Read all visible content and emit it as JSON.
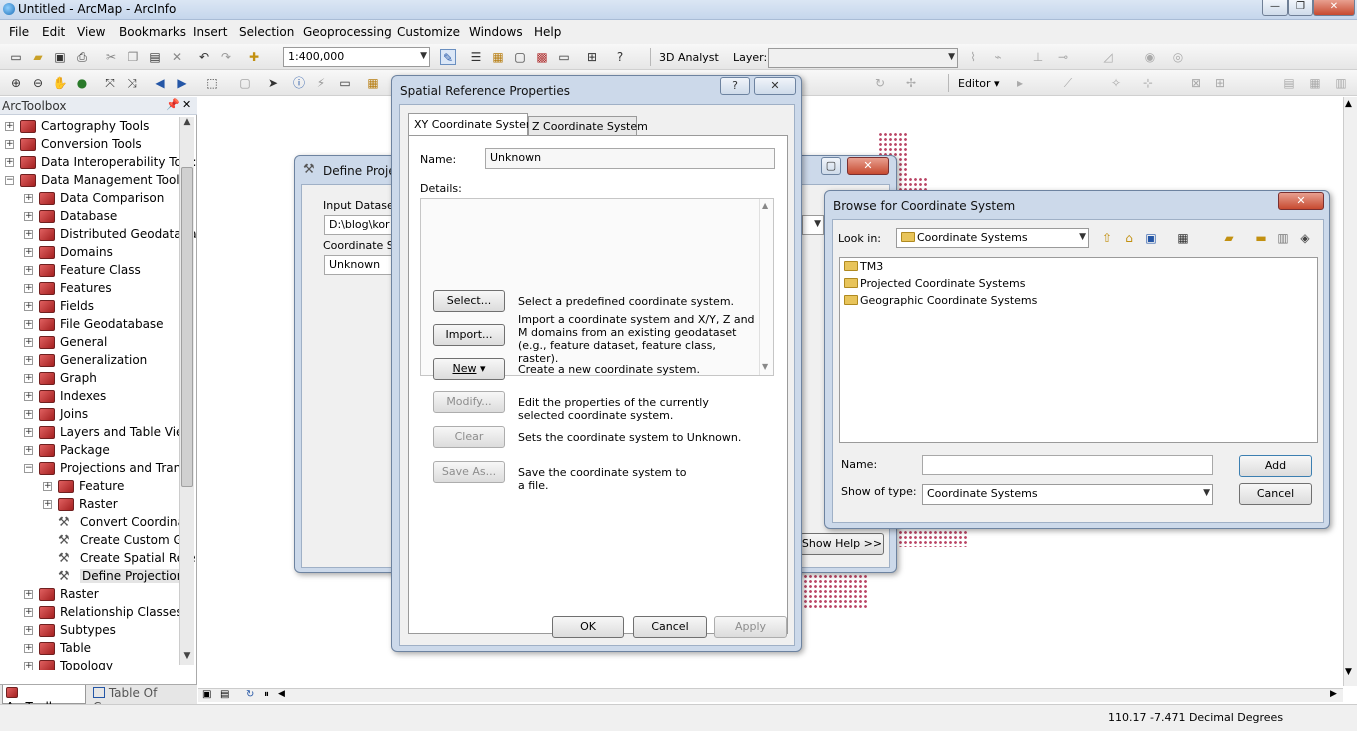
{
  "window": {
    "title": "Untitled - ArcMap - ArcInfo",
    "min": "—",
    "max": "❐",
    "close": "✕"
  },
  "menu": [
    "File",
    "Edit",
    "View",
    "Bookmarks",
    "Insert",
    "Selection",
    "Geoprocessing",
    "Customize",
    "Windows",
    "Help"
  ],
  "toolbar": {
    "scale": "1:400,000",
    "analyst": "3D Analyst",
    "layer_label": "Layer:",
    "editor": "Editor"
  },
  "toolbox": {
    "title": "ArcToolbox",
    "items": [
      {
        "label": "Cartography Tools",
        "level": 0,
        "exp": "+",
        "kind": "toolbox"
      },
      {
        "label": "Conversion Tools",
        "level": 0,
        "exp": "+",
        "kind": "toolbox"
      },
      {
        "label": "Data Interoperability Tool:",
        "level": 0,
        "exp": "+",
        "kind": "toolbox"
      },
      {
        "label": "Data Management Tools",
        "level": 0,
        "exp": "−",
        "kind": "toolbox"
      },
      {
        "label": "Data Comparison",
        "level": 1,
        "exp": "+",
        "kind": "toolbox"
      },
      {
        "label": "Database",
        "level": 1,
        "exp": "+",
        "kind": "toolbox"
      },
      {
        "label": "Distributed Geodataba",
        "level": 1,
        "exp": "+",
        "kind": "toolbox"
      },
      {
        "label": "Domains",
        "level": 1,
        "exp": "+",
        "kind": "toolbox"
      },
      {
        "label": "Feature Class",
        "level": 1,
        "exp": "+",
        "kind": "toolbox"
      },
      {
        "label": "Features",
        "level": 1,
        "exp": "+",
        "kind": "toolbox"
      },
      {
        "label": "Fields",
        "level": 1,
        "exp": "+",
        "kind": "toolbox"
      },
      {
        "label": "File Geodatabase",
        "level": 1,
        "exp": "+",
        "kind": "toolbox"
      },
      {
        "label": "General",
        "level": 1,
        "exp": "+",
        "kind": "toolbox"
      },
      {
        "label": "Generalization",
        "level": 1,
        "exp": "+",
        "kind": "toolbox"
      },
      {
        "label": "Graph",
        "level": 1,
        "exp": "+",
        "kind": "toolbox"
      },
      {
        "label": "Indexes",
        "level": 1,
        "exp": "+",
        "kind": "toolbox"
      },
      {
        "label": "Joins",
        "level": 1,
        "exp": "+",
        "kind": "toolbox"
      },
      {
        "label": "Layers and Table View",
        "level": 1,
        "exp": "+",
        "kind": "toolbox"
      },
      {
        "label": "Package",
        "level": 1,
        "exp": "+",
        "kind": "toolbox"
      },
      {
        "label": "Projections and Transf",
        "level": 1,
        "exp": "−",
        "kind": "toolbox"
      },
      {
        "label": "Feature",
        "level": 2,
        "exp": "+",
        "kind": "toolbox"
      },
      {
        "label": "Raster",
        "level": 2,
        "exp": "+",
        "kind": "toolbox"
      },
      {
        "label": "Convert Coordinat",
        "level": 2,
        "exp": "",
        "kind": "tool"
      },
      {
        "label": "Create Custom Ge",
        "level": 2,
        "exp": "",
        "kind": "tool"
      },
      {
        "label": "Create Spatial Refe",
        "level": 2,
        "exp": "",
        "kind": "tool"
      },
      {
        "label": "Define Projection",
        "level": 2,
        "exp": "",
        "kind": "tool"
      },
      {
        "label": "Raster",
        "level": 1,
        "exp": "+",
        "kind": "toolbox"
      },
      {
        "label": "Relationship Classes",
        "level": 1,
        "exp": "+",
        "kind": "toolbox"
      },
      {
        "label": "Subtypes",
        "level": 1,
        "exp": "+",
        "kind": "toolbox"
      },
      {
        "label": "Table",
        "level": 1,
        "exp": "+",
        "kind": "toolbox"
      },
      {
        "label": "Topology",
        "level": 1,
        "exp": "+",
        "kind": "toolbox"
      }
    ],
    "tabs": [
      "ArcToolbox",
      "Table Of Co..."
    ]
  },
  "define_projection": {
    "title": "Define Projec",
    "input_label": "Input Dataset",
    "input_value": "D:\\blog\\kor",
    "coord_label": "Coordinate Sy",
    "coord_value": "Unknown",
    "show_help": "Show Help >>"
  },
  "srp": {
    "title": "Spatial Reference Properties",
    "help": "?",
    "close": "✕",
    "tab_xy": "XY Coordinate System",
    "tab_z": "Z Coordinate System",
    "name_label": "Name:",
    "name_value": "Unknown",
    "details_label": "Details:",
    "actions": [
      {
        "button": "Select...",
        "desc": "Select a predefined coordinate system.",
        "enabled": true
      },
      {
        "button": "Import...",
        "desc": "Import a coordinate system and X/Y, Z and M domains from an existing geodataset (e.g., feature dataset, feature class, raster).",
        "enabled": true
      },
      {
        "button": "New",
        "desc": "Create a new coordinate system.",
        "enabled": true
      },
      {
        "button": "Modify...",
        "desc": "Edit the properties of the currently selected coordinate system.",
        "enabled": false
      },
      {
        "button": "Clear",
        "desc": "Sets the coordinate system to Unknown.",
        "enabled": false
      },
      {
        "button": "Save As...",
        "desc": "Save the coordinate system to a file.",
        "enabled": false
      }
    ],
    "ok": "OK",
    "cancel": "Cancel",
    "apply": "Apply"
  },
  "browse": {
    "title": "Browse for Coordinate System",
    "close": "✕",
    "look_in_label": "Look in:",
    "look_in_value": "Coordinate Systems",
    "items": [
      "TM3",
      "Projected Coordinate Systems",
      "Geographic Coordinate Systems"
    ],
    "name_label": "Name:",
    "name_value": "",
    "type_label": "Show of type:",
    "type_value": "Coordinate Systems",
    "add": "Add",
    "cancel": "Cancel"
  },
  "status": {
    "coords": "110.17  -7.471 Decimal Degrees"
  },
  "colors": {
    "accent": "#ccd9ea",
    "map_features": "#a8163f"
  }
}
